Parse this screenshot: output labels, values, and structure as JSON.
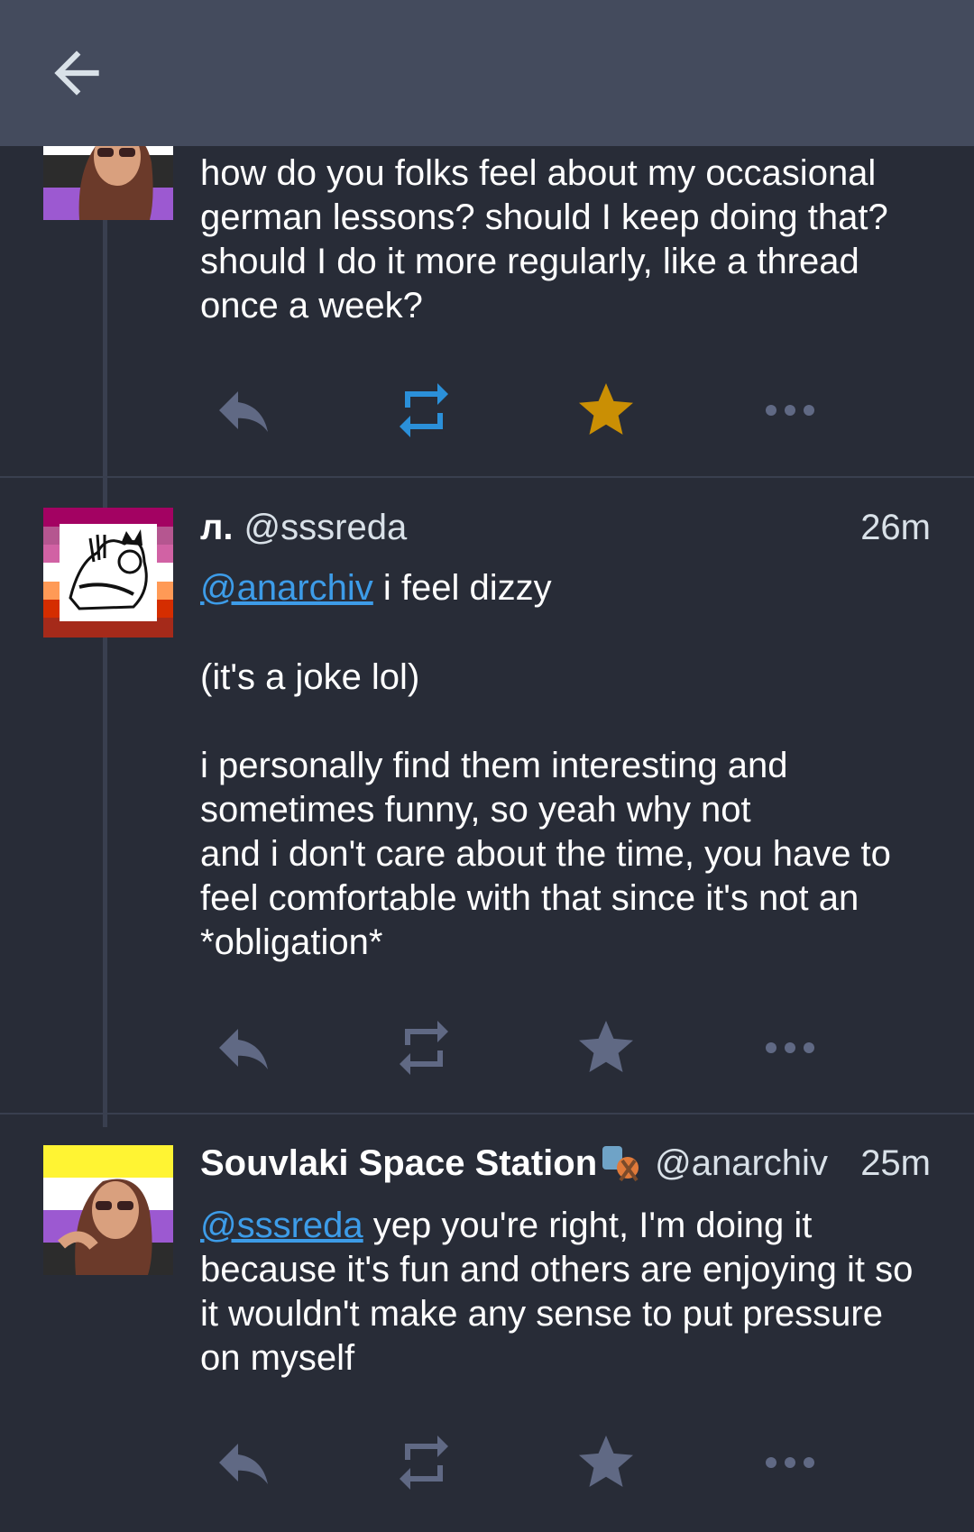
{
  "header": {
    "back_icon": "arrow-left-icon"
  },
  "colors": {
    "background": "#282c37",
    "topbar": "#444b5d",
    "icon_inactive": "#606984",
    "reblogged": "#2b90d9",
    "favourited": "#ca8f04",
    "mention": "#3d9ce8"
  },
  "statuses": [
    {
      "content": "how do you folks feel about my occasional german lessons? should I keep doing that? should I do it more regularly, like a thread once a week?",
      "reblogged": true,
      "favourited": true
    },
    {
      "display_name": "л.",
      "username": "@sssreda",
      "time": "26m",
      "mention": "@anarchiv",
      "content_first": " i feel dizzy",
      "content_rest": "(it's a joke lol)\n\ni personally find them interesting and sometimes funny, so yeah why not\nand i don't care about the time, you have to feel comfortable with that since it's not an *obligation*",
      "reblogged": false,
      "favourited": false
    },
    {
      "display_name": "Souvlaki Space Station",
      "username": "@anarchiv",
      "time": "25m",
      "mention": "@sssreda",
      "content": " yep you're right, I'm doing it because it's fun and others are enjoying it so it wouldn't make any sense to put pressure on myself",
      "reblogged": false,
      "favourited": false
    }
  ]
}
